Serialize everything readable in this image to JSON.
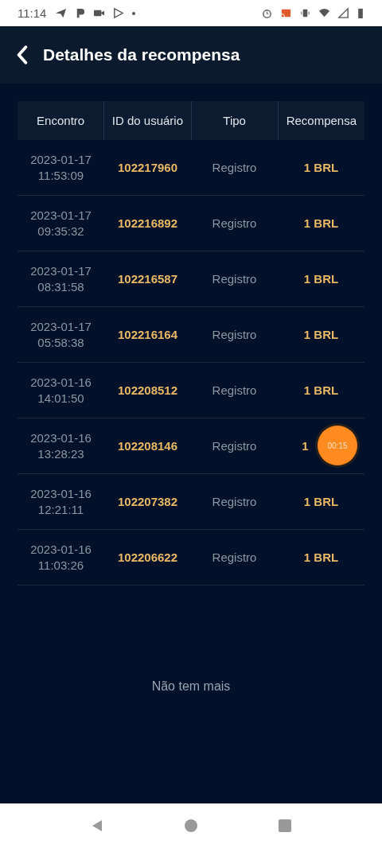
{
  "status_bar": {
    "time": "11:14"
  },
  "header": {
    "title": "Detalhes da recompensa"
  },
  "table": {
    "columns": [
      "Encontro",
      "ID do usuário",
      "Tipo",
      "Recompensa"
    ],
    "rows": [
      {
        "date": "2023-01-17",
        "time": "11:53:09",
        "user_id": "102217960",
        "type": "Registro",
        "reward": "1 BRL"
      },
      {
        "date": "2023-01-17",
        "time": "09:35:32",
        "user_id": "102216892",
        "type": "Registro",
        "reward": "1 BRL"
      },
      {
        "date": "2023-01-17",
        "time": "08:31:58",
        "user_id": "102216587",
        "type": "Registro",
        "reward": "1 BRL"
      },
      {
        "date": "2023-01-17",
        "time": "05:58:38",
        "user_id": "102216164",
        "type": "Registro",
        "reward": "1 BRL"
      },
      {
        "date": "2023-01-16",
        "time": "14:01:50",
        "user_id": "102208512",
        "type": "Registro",
        "reward": "1 BRL"
      },
      {
        "date": "2023-01-16",
        "time": "13:28:23",
        "user_id": "102208146",
        "type": "Registro",
        "reward": "1",
        "timer": "00:15"
      },
      {
        "date": "2023-01-16",
        "time": "12:21:11",
        "user_id": "102207382",
        "type": "Registro",
        "reward": "1 BRL"
      },
      {
        "date": "2023-01-16",
        "time": "11:03:26",
        "user_id": "102206622",
        "type": "Registro",
        "reward": "1 BRL"
      }
    ]
  },
  "footer_text": "Não tem mais"
}
